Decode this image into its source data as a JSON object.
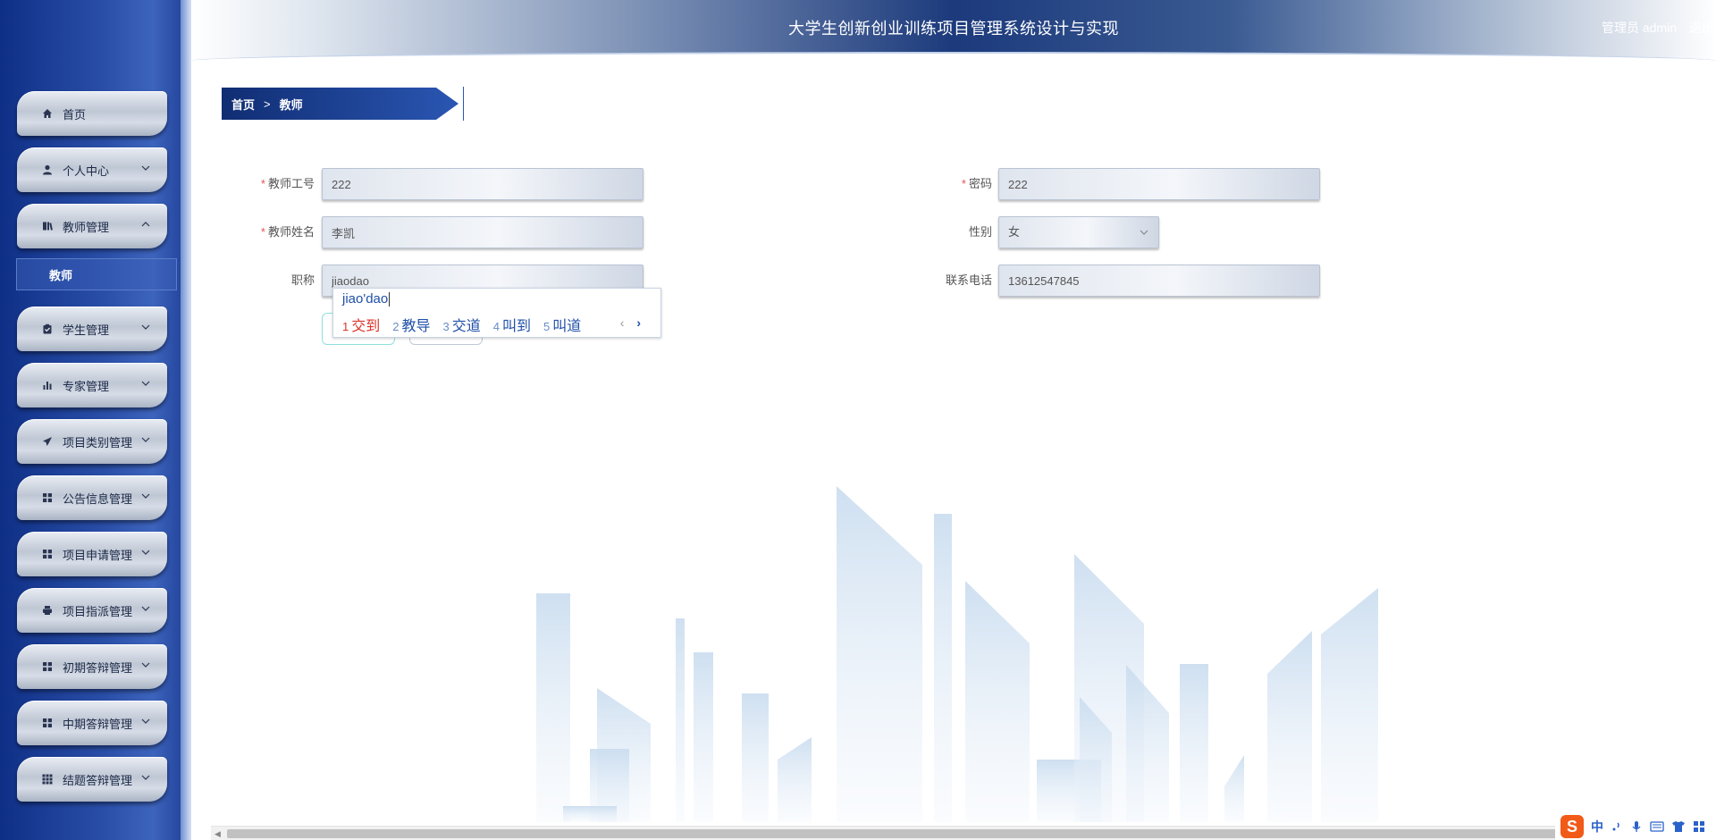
{
  "header": {
    "title": "大学生创新创业训练项目管理系统设计与实现",
    "user_label": "管理员 admin",
    "logout_label": "退出登录"
  },
  "sidebar": {
    "items": [
      {
        "label": "首页",
        "icon": "home-icon"
      },
      {
        "label": "个人中心",
        "icon": "user-icon"
      },
      {
        "label": "教师管理",
        "icon": "book-icon"
      },
      {
        "label": "学生管理",
        "icon": "clipboard-icon"
      },
      {
        "label": "专家管理",
        "icon": "bar-chart-icon"
      },
      {
        "label": "项目类别管理",
        "icon": "paper-plane-icon"
      },
      {
        "label": "公告信息管理",
        "icon": "grid-icon"
      },
      {
        "label": "项目申请管理",
        "icon": "grid-icon"
      },
      {
        "label": "项目指派管理",
        "icon": "printer-icon"
      },
      {
        "label": "初期答辩管理",
        "icon": "grid-icon"
      },
      {
        "label": "中期答辩管理",
        "icon": "grid-icon"
      },
      {
        "label": "结题答辩管理",
        "icon": "apps-icon"
      }
    ],
    "submenu": {
      "label": "教师"
    }
  },
  "breadcrumb": {
    "home": "首页",
    "separator": ">",
    "current": "教师"
  },
  "form": {
    "teacher_id": {
      "label": "教师工号",
      "value": "222"
    },
    "password": {
      "label": "密码",
      "value": "222"
    },
    "teacher_name": {
      "label": "教师姓名",
      "value": "李凯"
    },
    "gender": {
      "label": "性别",
      "value": "女"
    },
    "title": {
      "label": "职称",
      "value": "jiaodao"
    },
    "phone": {
      "label": "联系电话",
      "value": "13612547845"
    }
  },
  "ime": {
    "composition": "jiao'dao",
    "candidates": [
      {
        "num": "1",
        "text": "交到"
      },
      {
        "num": "2",
        "text": "教导"
      },
      {
        "num": "3",
        "text": "交道"
      },
      {
        "num": "4",
        "text": "叫到"
      },
      {
        "num": "5",
        "text": "叫道"
      }
    ],
    "prev": "‹",
    "next": "›",
    "toolbar": {
      "logo": "S",
      "mode": "中"
    }
  },
  "colors": {
    "sidebar_bg": "#1d3c93",
    "header_center": "#1c3a7c",
    "required": "#e25555",
    "ime_blue": "#1f4fa8",
    "ime_selected": "#d9342b"
  }
}
